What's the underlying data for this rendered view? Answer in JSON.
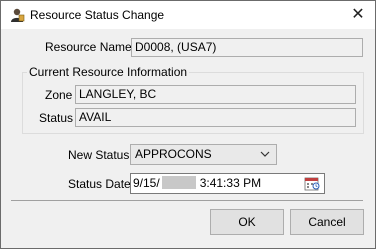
{
  "window": {
    "title": "Resource Status Change",
    "close_glyph": "✕",
    "icon": "user-icon"
  },
  "resource": {
    "label": "Resource Name",
    "value": "D0008, (USA7)"
  },
  "current_info": {
    "group_label": "Current Resource Information",
    "zone_label": "Zone",
    "zone_value": "LANGLEY, BC",
    "status_label": "Status",
    "status_value": "AVAIL"
  },
  "new_status": {
    "label": "New Status",
    "selected": "APPROCONS"
  },
  "status_date": {
    "label": "Status Date",
    "date_prefix": "9/15/",
    "time": "3:41:33 PM"
  },
  "buttons": {
    "ok_label": "OK",
    "cancel_label": "Cancel"
  }
}
